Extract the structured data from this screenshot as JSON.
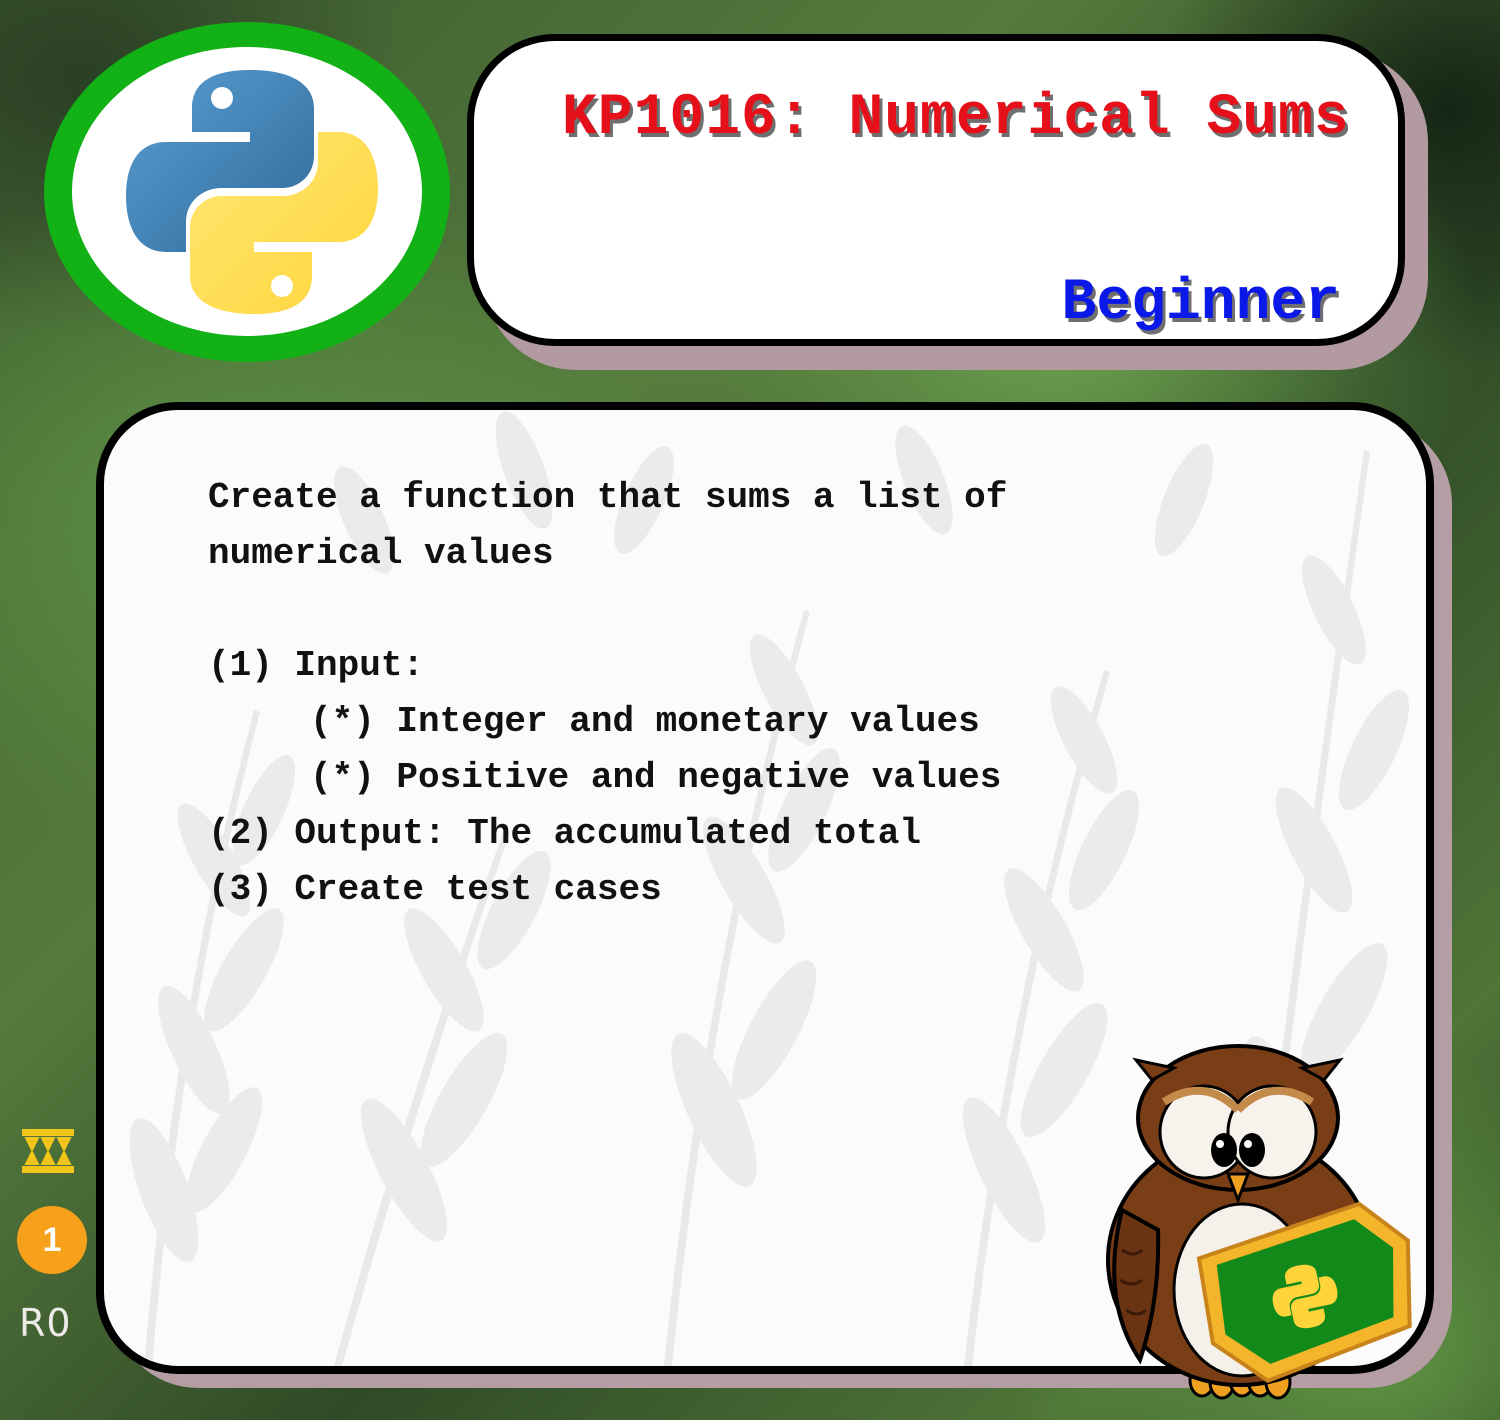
{
  "card": {
    "title": "KP1016: Numerical Sums",
    "level": "Beginner",
    "description": "Create a function that sums a list of\nnumerical values",
    "requirements": [
      "(1) Input:",
      "(*) Integer and monetary values",
      "(*) Positive and negative values",
      "(2) Output: The accumulated total",
      "(3) Create test cases"
    ]
  },
  "icons": {
    "logo": "python-logo-icon",
    "mascot": "owl-mascot-icon",
    "symbol": "triangle-pattern-icon"
  },
  "status": {
    "count": "1",
    "label": "R0"
  },
  "colors": {
    "title": "#e5101a",
    "level": "#0a18e8",
    "logo_ring": "#12b116",
    "badge": "#f7a01a",
    "symbol": "#f2c51c"
  }
}
